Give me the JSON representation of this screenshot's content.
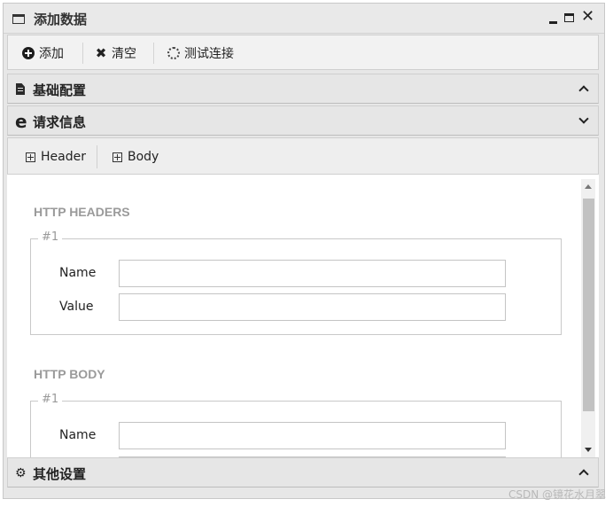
{
  "window": {
    "title": "添加数据"
  },
  "toolbar": {
    "add_label": "添加",
    "clear_label": "清空",
    "test_label": "测试连接"
  },
  "panels": {
    "basic": {
      "label": "基础配置"
    },
    "request": {
      "label": "请求信息"
    },
    "other": {
      "label": "其他设置"
    }
  },
  "subtabs": {
    "header_label": "Header",
    "body_label": "Body"
  },
  "headers_section": {
    "title": "HTTP HEADERS",
    "legend": "#1",
    "name_label": "Name",
    "value_label": "Value",
    "name_value": "",
    "value_value": ""
  },
  "body_section": {
    "title": "HTTP BODY",
    "legend": "#1",
    "name_label": "Name",
    "name_value": ""
  },
  "watermark": "CSDN @镜花水月翠"
}
